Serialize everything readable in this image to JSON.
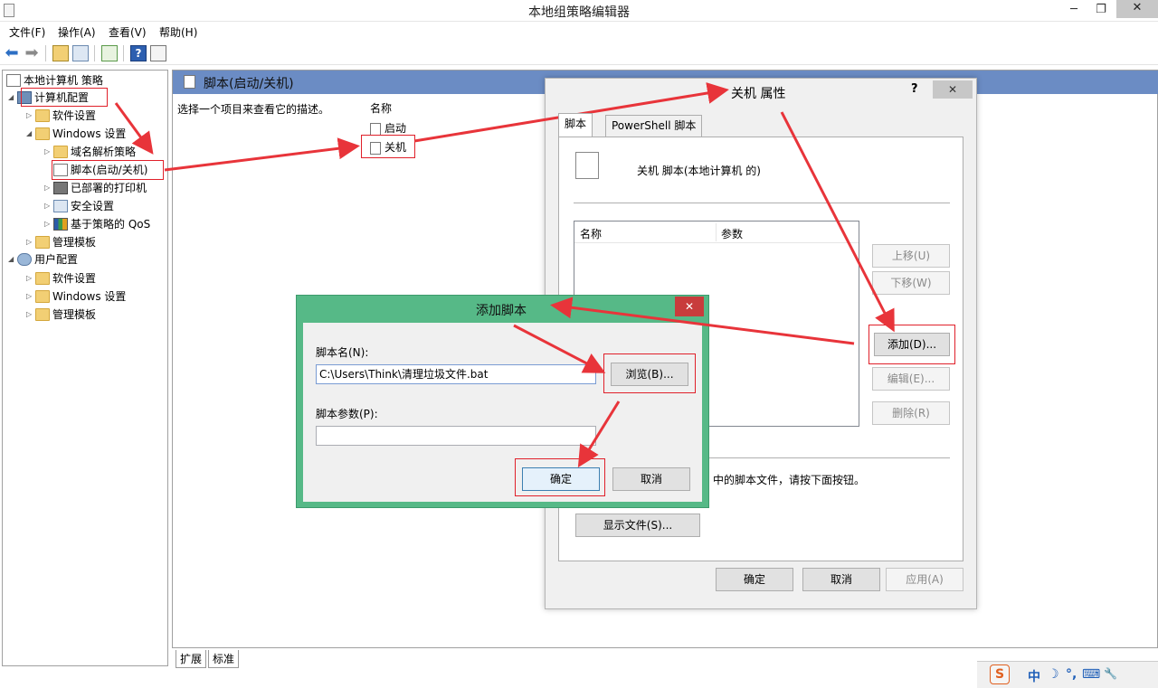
{
  "window": {
    "title": "本地组策略编辑器",
    "minimize": "─",
    "maximize": "❐",
    "close": "✕"
  },
  "menu": [
    "文件(F)",
    "操作(A)",
    "查看(V)",
    "帮助(H)"
  ],
  "tree": {
    "root": "本地计算机 策略",
    "computer_config": "计算机配置",
    "software_settings": "软件设置",
    "windows_settings": "Windows 设置",
    "dns": "域名解析策略",
    "scripts": "脚本(启动/关机)",
    "printers": "已部署的打印机",
    "security": "安全设置",
    "qos": "基于策略的 QoS",
    "admin_templates": "管理模板",
    "user_config": "用户配置",
    "user_software": "软件设置",
    "user_windows": "Windows 设置",
    "user_admin": "管理模板"
  },
  "right_pane": {
    "header": "脚本(启动/关机)",
    "description": "选择一个项目来查看它的描述。",
    "column_name": "名称",
    "items": [
      "启动",
      "关机"
    ]
  },
  "bottom_tabs": [
    "扩展",
    "标准"
  ],
  "props_dialog": {
    "title": "关机 属性",
    "help": "?",
    "close": "✕",
    "tabs": [
      "脚本",
      "PowerShell 脚本"
    ],
    "heading": "关机 脚本(本地计算机 的)",
    "list_headers": [
      "名称",
      "参数"
    ],
    "buttons": {
      "up": "上移(U)",
      "down": "下移(W)",
      "add": "添加(D)...",
      "edit": "编辑(E)...",
      "remove": "删除(R)",
      "show_files": "显示文件(S)...",
      "ok": "确定",
      "cancel": "取消",
      "apply": "应用(A)"
    },
    "hint": "中的脚本文件，请按下面按钮。"
  },
  "add_dialog": {
    "title": "添加脚本",
    "close": "✕",
    "name_label": "脚本名(N):",
    "name_value": "C:\\Users\\Think\\清理垃圾文件.bat",
    "browse": "浏览(B)...",
    "params_label": "脚本参数(P):",
    "params_value": "",
    "ok": "确定",
    "cancel": "取消"
  },
  "ime": {
    "logo": "S",
    "mode": "中",
    "moon": "☽",
    "punct": "°,",
    "keyboard": "⌨",
    "tool": "🔧"
  },
  "colors": {
    "pane_header": "#6b8cc4",
    "add_dialog_frame": "#56b987",
    "annotation_red": "#e0202a"
  }
}
